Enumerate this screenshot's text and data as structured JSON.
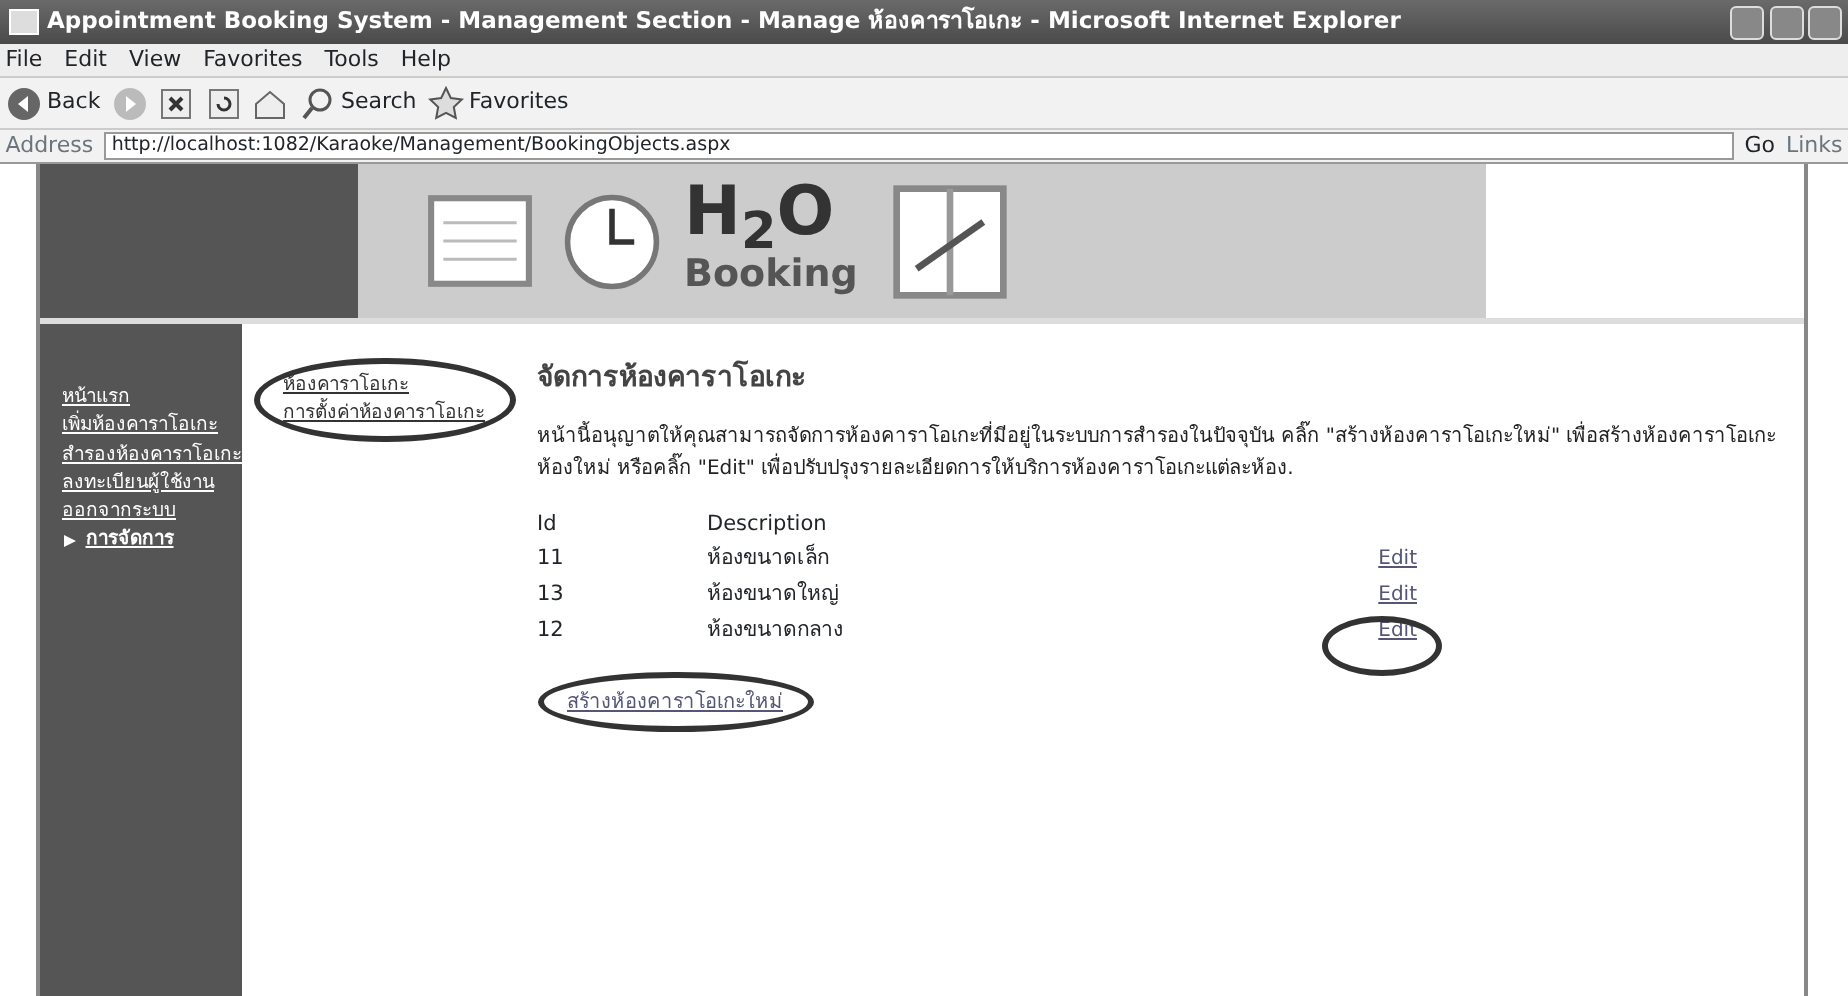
{
  "window": {
    "title": "Appointment Booking System - Management Section - Manage ห้องคาราโอเกะ - Microsoft Internet Explorer"
  },
  "menu": [
    "File",
    "Edit",
    "View",
    "Favorites",
    "Tools",
    "Help"
  ],
  "toolbar": [
    {
      "kind": "back",
      "label": "Back"
    },
    {
      "kind": "forward"
    },
    {
      "kind": "stop"
    },
    {
      "kind": "refresh"
    },
    {
      "kind": "home"
    },
    {
      "kind": "search",
      "label": "Search"
    },
    {
      "kind": "favorites",
      "label": "Favorites"
    }
  ],
  "address": {
    "label": "Address",
    "value": "http://localhost:1082/Karaoke/Management/BookingObjects.aspx",
    "go": "Go",
    "links": "Links"
  },
  "banner": {
    "logo": "H$_{2}$O",
    "subtitle": "Booking"
  },
  "sidebar": {
    "items": [
      {
        "label": "หน้าแรก",
        "selected": false
      },
      {
        "label": "เพิ่มห้องคาราโอเกะ",
        "selected": false
      },
      {
        "label": "สำรองห้องคาราโอเกะ",
        "selected": false
      },
      {
        "label": "ลงทะเบียนผู้ใช้งาน",
        "selected": false
      },
      {
        "label": "ออกจากระบบ",
        "selected": false
      },
      {
        "label": "การจัดการ",
        "selected": true
      }
    ]
  },
  "submenu": {
    "circled": true,
    "items": [
      "ห้องคาราโอเกะ",
      "การตั้งค่าห้องคาราโอเกะ"
    ]
  },
  "content": {
    "title": "จัดการห้องคาราโอเกะ",
    "description": "หน้านี้อนุญาตให้คุณสามารถจัดการห้องคาราโอเกะที่มีอยู่ในระบบการสำรองในปัจจุบัน คลิ๊ก \"สร้างห้องคาราโอเกะใหม่\" เพื่อสร้างห้องคาราโอเกะห้องใหม่ หรือคลิ๊ก \"Edit\" เพื่อปรับปรุงรายละเอียดการให้บริการห้องคาราโอเกะแต่ละห้อง.",
    "table": {
      "columns": [
        "Id",
        "Description"
      ],
      "edit_circled": true,
      "rows": [
        {
          "id": "11",
          "description": "ห้องขนาดเล็ก",
          "action": "Edit"
        },
        {
          "id": "13",
          "description": "ห้องขนาดใหญ่",
          "action": "Edit"
        },
        {
          "id": "12",
          "description": "ห้องขนาดกลาง",
          "action": "Edit"
        }
      ]
    },
    "create_link": {
      "label": "สร้างห้องคาราโอเกะใหม่",
      "circled": true
    }
  }
}
